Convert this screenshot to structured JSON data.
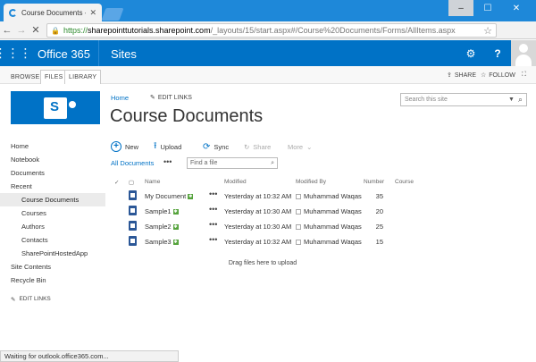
{
  "browser": {
    "tab_title": "Course Documents - All D",
    "url_scheme": "https://",
    "url_host": "sharepointtutorials.sharepoint.com",
    "url_path": "/_layouts/15/start.aspx#/Course%20Documents/Forms/AllItems.aspx",
    "status": "Waiting for outlook.office365.com..."
  },
  "suite": {
    "brand": "Office 365",
    "app": "Sites"
  },
  "ribbon": {
    "tabs": [
      "BROWSE",
      "FILES",
      "LIBRARY"
    ],
    "share": "SHARE",
    "follow": "FOLLOW"
  },
  "site": {
    "breadcrumb_home": "Home",
    "edit_links": "EDIT LINKS",
    "title": "Course Documents",
    "search_placeholder": "Search this site"
  },
  "nav": {
    "items": [
      "Home",
      "Notebook",
      "Documents",
      "Recent"
    ],
    "recent": [
      "Course Documents",
      "Courses",
      "Authors",
      "Contacts",
      "SharePointHostedApp"
    ],
    "bottom": [
      "Site Contents",
      "Recycle Bin"
    ],
    "edit_links": "EDIT LINKS"
  },
  "commands": {
    "new": "New",
    "upload": "Upload",
    "sync": "Sync",
    "share": "Share",
    "more": "More"
  },
  "view": {
    "current": "All Documents",
    "find_placeholder": "Find a file"
  },
  "list": {
    "columns": {
      "name": "Name",
      "modified": "Modified",
      "modified_by": "Modified By",
      "number": "Number",
      "course": "Course"
    },
    "rows": [
      {
        "name": "My Document",
        "modified": "Yesterday at 10:32 AM",
        "by": "Muhammad Waqas",
        "number": "35",
        "course": ""
      },
      {
        "name": "Sample1",
        "modified": "Yesterday at 10:30 AM",
        "by": "Muhammad Waqas",
        "number": "20",
        "course": ""
      },
      {
        "name": "Sample2",
        "modified": "Yesterday at 10:30 AM",
        "by": "Muhammad Waqas",
        "number": "25",
        "course": ""
      },
      {
        "name": "Sample3",
        "modified": "Yesterday at 10:32 AM",
        "by": "Muhammad Waqas",
        "number": "15",
        "course": ""
      }
    ],
    "drop_hint": "Drag files here to upload"
  }
}
